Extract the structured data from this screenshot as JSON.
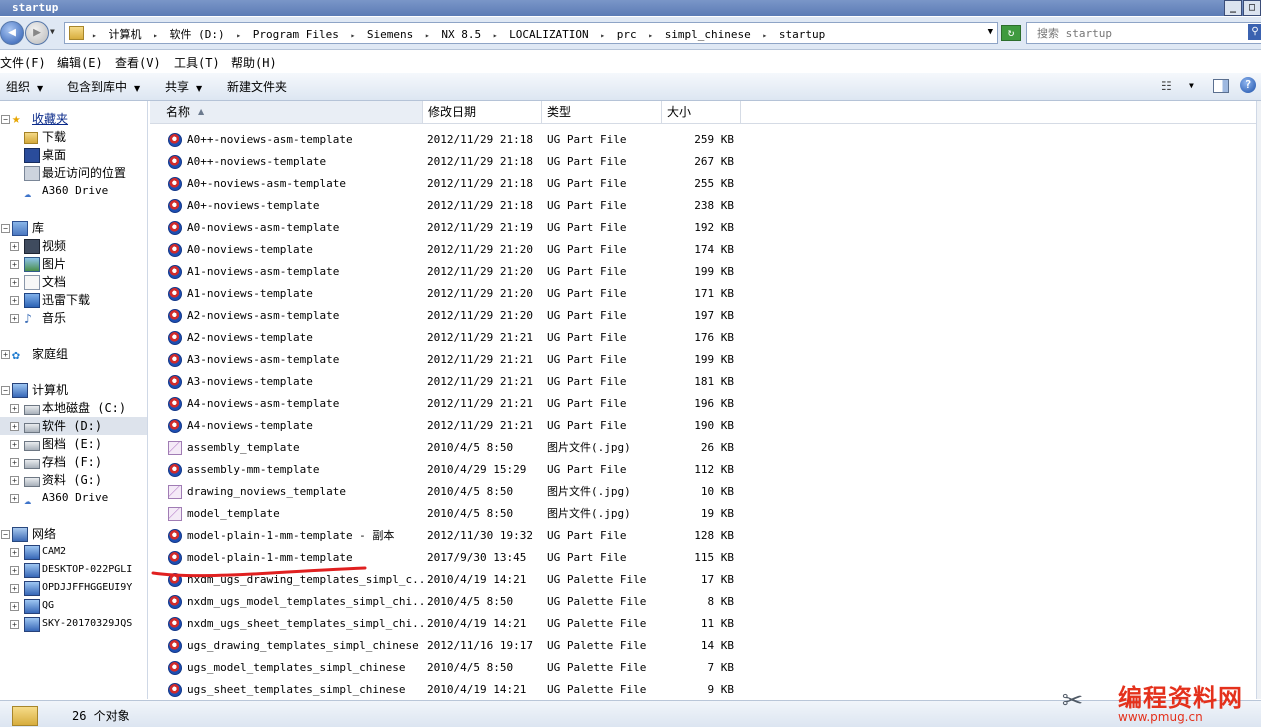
{
  "window": {
    "title": "startup",
    "buttons": [
      "_",
      "□"
    ]
  },
  "address": {
    "breadcrumbs": [
      "计算机",
      "软件 (D:)",
      "Program Files",
      "Siemens",
      "NX 8.5",
      "LOCALIZATION",
      "prc",
      "simpl_chinese",
      "startup"
    ],
    "search_placeholder": "搜索 startup"
  },
  "menu": [
    "文件(F)",
    "编辑(E)",
    "查看(V)",
    "工具(T)",
    "帮助(H)"
  ],
  "toolbar": {
    "organize": "组织",
    "include_in_library": "包含到库中",
    "share": "共享",
    "new_folder": "新建文件夹"
  },
  "nav": {
    "favorites": {
      "label": "收藏夹",
      "items": [
        "下载",
        "桌面",
        "最近访问的位置",
        "A360 Drive"
      ]
    },
    "libraries": {
      "label": "库",
      "items": [
        "视频",
        "图片",
        "文档",
        "迅雷下载",
        "音乐"
      ]
    },
    "homegroup": "家庭组",
    "computer": {
      "label": "计算机",
      "items": [
        "本地磁盘 (C:)",
        "软件 (D:)",
        "图档 (E:)",
        "存档 (F:)",
        "资料 (G:)",
        "A360 Drive"
      ]
    },
    "network": {
      "label": "网络",
      "items": [
        "CAM2",
        "DESKTOP-022PGLI",
        "OPDJJFFHGGEUI9Y",
        "QG",
        "SKY-20170329JQS"
      ]
    }
  },
  "columns": {
    "name": "名称",
    "date": "修改日期",
    "type": "类型",
    "size": "大小"
  },
  "files": [
    {
      "icon": "ug-part-icon",
      "name": "A0++-noviews-asm-template",
      "date": "2012/11/29 21:18",
      "type": "UG Part File",
      "size": "259 KB"
    },
    {
      "icon": "ug-part-icon",
      "name": "A0++-noviews-template",
      "date": "2012/11/29 21:18",
      "type": "UG Part File",
      "size": "267 KB"
    },
    {
      "icon": "ug-part-icon",
      "name": "A0+-noviews-asm-template",
      "date": "2012/11/29 21:18",
      "type": "UG Part File",
      "size": "255 KB"
    },
    {
      "icon": "ug-part-icon",
      "name": "A0+-noviews-template",
      "date": "2012/11/29 21:18",
      "type": "UG Part File",
      "size": "238 KB"
    },
    {
      "icon": "ug-part-icon",
      "name": "A0-noviews-asm-template",
      "date": "2012/11/29 21:19",
      "type": "UG Part File",
      "size": "192 KB"
    },
    {
      "icon": "ug-part-icon",
      "name": "A0-noviews-template",
      "date": "2012/11/29 21:20",
      "type": "UG Part File",
      "size": "174 KB"
    },
    {
      "icon": "ug-part-icon",
      "name": "A1-noviews-asm-template",
      "date": "2012/11/29 21:20",
      "type": "UG Part File",
      "size": "199 KB"
    },
    {
      "icon": "ug-part-icon",
      "name": "A1-noviews-template",
      "date": "2012/11/29 21:20",
      "type": "UG Part File",
      "size": "171 KB"
    },
    {
      "icon": "ug-part-icon",
      "name": "A2-noviews-asm-template",
      "date": "2012/11/29 21:20",
      "type": "UG Part File",
      "size": "197 KB"
    },
    {
      "icon": "ug-part-icon",
      "name": "A2-noviews-template",
      "date": "2012/11/29 21:21",
      "type": "UG Part File",
      "size": "176 KB"
    },
    {
      "icon": "ug-part-icon",
      "name": "A3-noviews-asm-template",
      "date": "2012/11/29 21:21",
      "type": "UG Part File",
      "size": "199 KB"
    },
    {
      "icon": "ug-part-icon",
      "name": "A3-noviews-template",
      "date": "2012/11/29 21:21",
      "type": "UG Part File",
      "size": "181 KB"
    },
    {
      "icon": "ug-part-icon",
      "name": "A4-noviews-asm-template",
      "date": "2012/11/29 21:21",
      "type": "UG Part File",
      "size": "196 KB"
    },
    {
      "icon": "ug-part-icon",
      "name": "A4-noviews-template",
      "date": "2012/11/29 21:21",
      "type": "UG Part File",
      "size": "190 KB"
    },
    {
      "icon": "image-file-icon",
      "name": "assembly_template",
      "date": "2010/4/5 8:50",
      "type": "图片文件(.jpg)",
      "size": "26 KB"
    },
    {
      "icon": "ug-part-icon",
      "name": "assembly-mm-template",
      "date": "2010/4/29 15:29",
      "type": "UG Part File",
      "size": "112 KB"
    },
    {
      "icon": "image-file-icon",
      "name": "drawing_noviews_template",
      "date": "2010/4/5 8:50",
      "type": "图片文件(.jpg)",
      "size": "10 KB"
    },
    {
      "icon": "image-file-icon",
      "name": "model_template",
      "date": "2010/4/5 8:50",
      "type": "图片文件(.jpg)",
      "size": "19 KB"
    },
    {
      "icon": "ug-part-icon",
      "name": "model-plain-1-mm-template - 副本",
      "date": "2012/11/30 19:32",
      "type": "UG Part File",
      "size": "128 KB"
    },
    {
      "icon": "ug-part-icon",
      "name": "model-plain-1-mm-template",
      "date": "2017/9/30 13:45",
      "type": "UG Part File",
      "size": "115 KB"
    },
    {
      "icon": "ug-palette-icon",
      "name": "nxdm_ugs_drawing_templates_simpl_c...",
      "date": "2010/4/19 14:21",
      "type": "UG Palette File",
      "size": "17 KB"
    },
    {
      "icon": "ug-palette-icon",
      "name": "nxdm_ugs_model_templates_simpl_chi...",
      "date": "2010/4/5 8:50",
      "type": "UG Palette File",
      "size": "8 KB"
    },
    {
      "icon": "ug-palette-icon",
      "name": "nxdm_ugs_sheet_templates_simpl_chi...",
      "date": "2010/4/19 14:21",
      "type": "UG Palette File",
      "size": "11 KB"
    },
    {
      "icon": "ug-palette-icon",
      "name": "ugs_drawing_templates_simpl_chinese",
      "date": "2012/11/16 19:17",
      "type": "UG Palette File",
      "size": "14 KB"
    },
    {
      "icon": "ug-palette-icon",
      "name": "ugs_model_templates_simpl_chinese",
      "date": "2010/4/5 8:50",
      "type": "UG Palette File",
      "size": "7 KB"
    },
    {
      "icon": "ug-palette-icon",
      "name": "ugs_sheet_templates_simpl_chinese",
      "date": "2010/4/19 14:21",
      "type": "UG Palette File",
      "size": "9 KB"
    }
  ],
  "status": {
    "count_text": "26 个对象"
  },
  "watermark": {
    "title": "编程资料网",
    "url": "www.pmug.cn"
  },
  "colors": {
    "annotation_red": "#e02020",
    "watermark_red": "#e4311c",
    "selected_bg": "#dde3ec"
  }
}
